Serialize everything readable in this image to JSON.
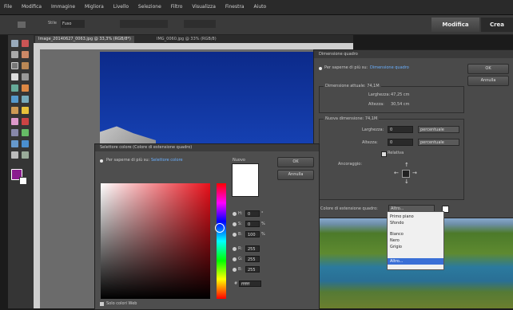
{
  "menu": [
    "File",
    "Modifica",
    "Immagine",
    "Migliora",
    "Livello",
    "Selezione",
    "Filtro",
    "Visualizza",
    "Finestra",
    "Aiuto"
  ],
  "mode_buttons": {
    "modifica": "Modifica",
    "crea": "Crea"
  },
  "options_bar": {
    "style_label": "Stile",
    "style_value": "Fuso"
  },
  "tabs": {
    "active": "Image_20140627_0063.jpg @ 33,3% (RGB/8*)",
    "second": "IMG_0060.jpg @ 33% (RGB/8)"
  },
  "resize_dialog": {
    "title": "Dimensione quadro",
    "info": "Per saperne di più su:",
    "info_link": "Dimensione quadro",
    "ok": "OK",
    "cancel": "Annulla",
    "current_size": "Dimensione attuale: 74,1M",
    "width_label": "Larghezza:",
    "width_value": "47,25 cm",
    "height_label": "Altezza:",
    "height_value": "30,54 cm",
    "new_size": "Nuova dimensione: 74,1M",
    "new_width_label": "Larghezza:",
    "new_width_value": "0",
    "new_height_label": "Altezza:",
    "new_height_value": "0",
    "unit": "percentuale",
    "relative": "Relativa",
    "anchor_label": "Ancoraggio:",
    "extension_color_label": "Colore di estensione quadro:",
    "extension_color_value": "Altro..."
  },
  "dropdown": [
    "Primo piano",
    "Sfondo",
    "Bianco",
    "Nero",
    "Grigio",
    "Altro..."
  ],
  "picker": {
    "title": "Selettore colore (Colore di estensione quadro)",
    "info": "Per saperne di più su:",
    "info_link": "Selettore colore",
    "ok": "OK",
    "cancel": "Annulla",
    "swatch_label": "Nuovo",
    "swatch_sub": "Corrente",
    "web_only": "Solo colori Web",
    "fields": [
      {
        "label": "H:",
        "value": "0",
        "unit": "°"
      },
      {
        "label": "S:",
        "value": "0",
        "unit": "%"
      },
      {
        "label": "B:",
        "value": "100",
        "unit": "%"
      },
      {
        "label": "R:",
        "value": "255",
        "unit": ""
      },
      {
        "label": "G:",
        "value": "255",
        "unit": ""
      },
      {
        "label": "B:",
        "value": "255",
        "unit": ""
      }
    ],
    "hex_label": "#",
    "hex_value": "ffffff"
  }
}
